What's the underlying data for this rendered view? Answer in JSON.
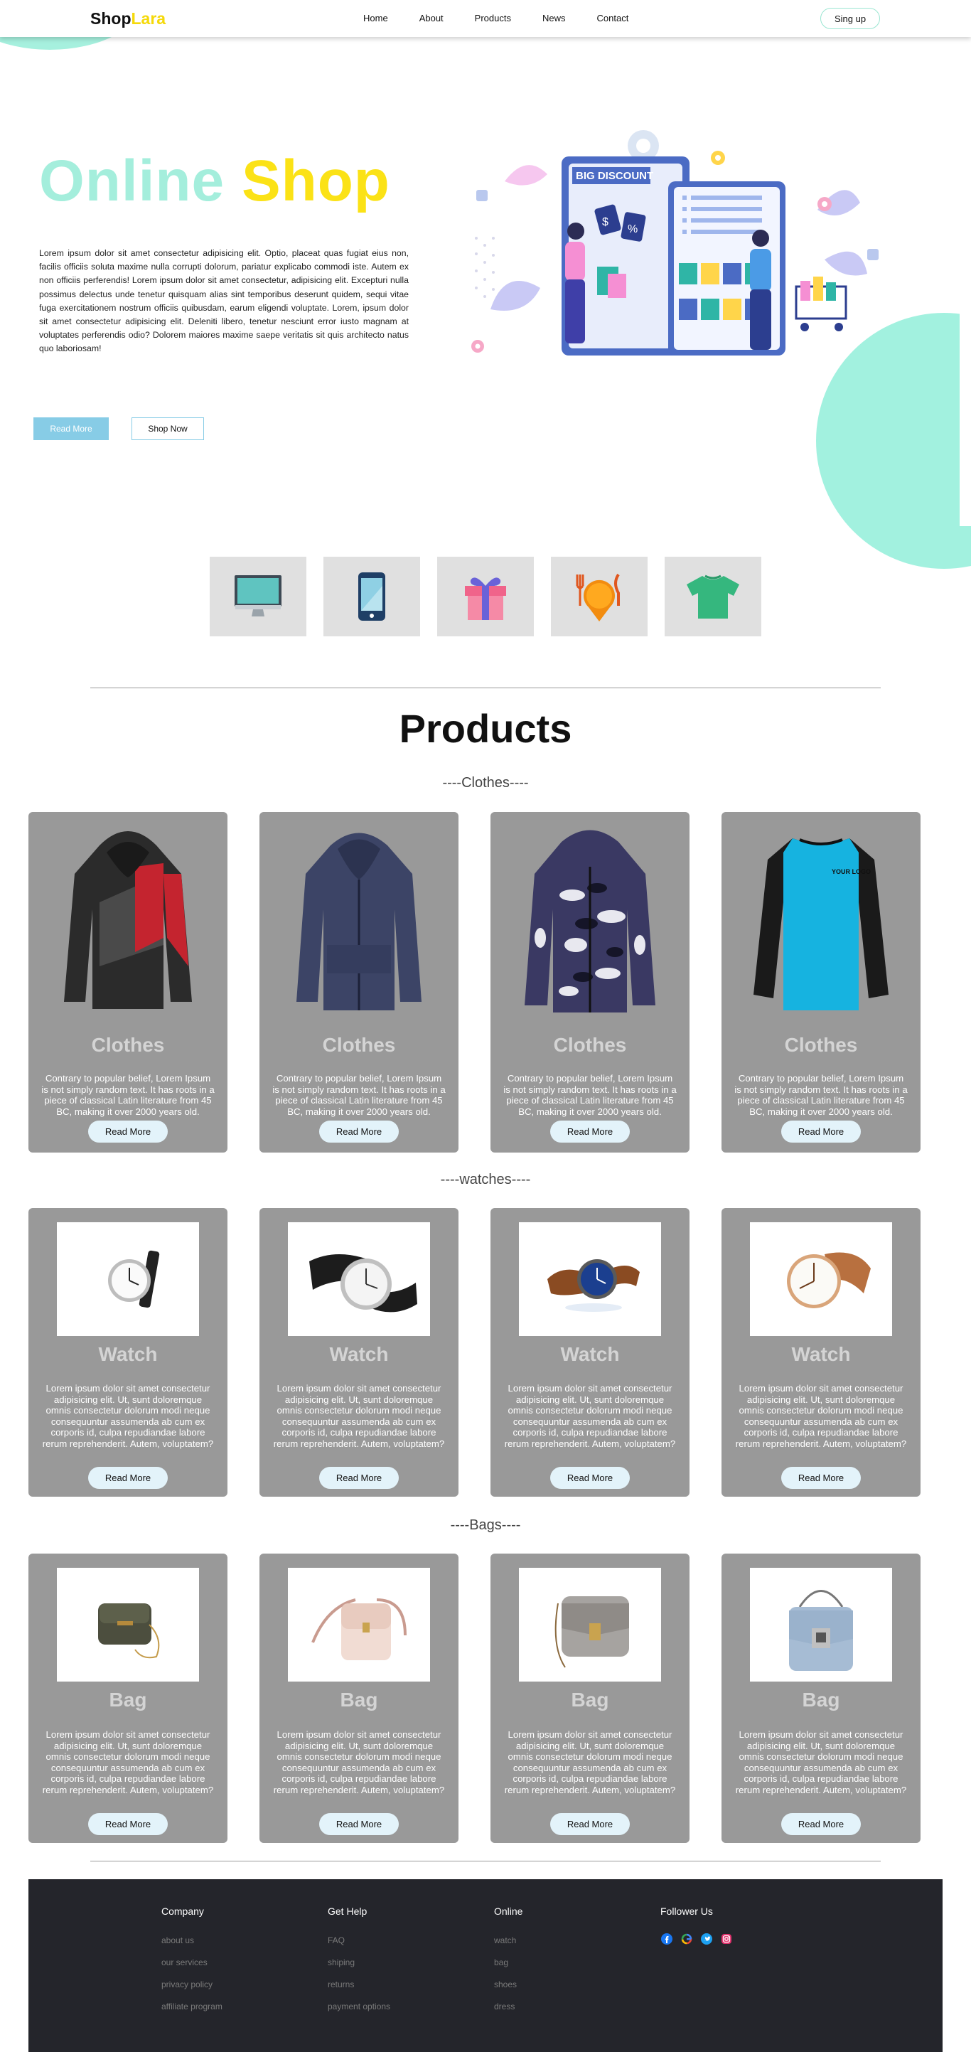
{
  "header": {
    "logo_part1": "Shop",
    "logo_part2": "Lara",
    "nav": [
      "Home",
      "About",
      "Products",
      "News",
      "Contact"
    ],
    "signup_label": "Sing up"
  },
  "hero": {
    "title_part1": "Online",
    "title_part2": "Shop",
    "text": "Lorem ipsum dolor sit amet consectetur adipisicing elit. Optio, placeat quas fugiat eius non, facilis officiis soluta maxime nulla corrupti dolorum, pariatur explicabo commodi iste. Autem ex non officiis perferendis! Lorem ipsum dolor sit amet consectetur, adipisicing elit. Excepturi nulla possimus delectus unde tenetur quisquam alias sint temporibus deserunt quidem, sequi vitae fuga exercitationem nostrum officiis quibusdam, earum eligendi voluptate. Lorem, ipsum dolor sit amet consectetur adipisicing elit. Deleniti libero, tenetur nesciunt error iusto magnam at voluptates perferendis odio? Dolorem maiores maxime saepe veritatis sit quis architecto natus quo laboriosam!",
    "read_more": "Read More",
    "shop_now": "Shop Now",
    "illustration_text": "BIG DISCOUNT"
  },
  "categories": [
    "monitor-icon",
    "smartphone-icon",
    "gift-icon",
    "food-icon",
    "tshirt-icon"
  ],
  "products": {
    "title": "Products",
    "sections": [
      {
        "label": "----Clothes----",
        "items": [
          {
            "title": "Clothes",
            "desc": "Contrary to popular belief, Lorem Ipsum is not simply random text. It has roots in a piece of classical Latin literature from 45 BC, making it over 2000 years old.",
            "button": "Read More",
            "image": "hoodie-red-black"
          },
          {
            "title": "Clothes",
            "desc": "Contrary to popular belief, Lorem Ipsum is not simply random text. It has roots in a piece of classical Latin literature from 45 BC, making it over 2000 years old.",
            "button": "Read More",
            "image": "hoodie-navy"
          },
          {
            "title": "Clothes",
            "desc": "Contrary to popular belief, Lorem Ipsum is not simply random text. It has roots in a piece of classical Latin literature from 45 BC, making it over 2000 years old.",
            "button": "Read More",
            "image": "jacket-camo"
          },
          {
            "title": "Clothes",
            "desc": "Contrary to popular belief, Lorem Ipsum is not simply random text. It has roots in a piece of classical Latin literature from 45 BC, making it over 2000 years old.",
            "button": "Read More",
            "image": "raglan-tee-blue",
            "logo_text": "YOUR LOGO"
          }
        ]
      },
      {
        "label": "----watches----",
        "items": [
          {
            "title": "Watch",
            "desc": "Lorem ipsum dolor sit amet consectetur adipisicing elit. Ut, sunt doloremque omnis consectetur dolorum modi neque consequuntur assumenda ab cum ex corporis id, culpa repudiandae labore rerum reprehenderit. Autem, voluptatem?",
            "button": "Read More",
            "image": "watch-black-strap"
          },
          {
            "title": "Watch",
            "desc": "Lorem ipsum dolor sit amet consectetur adipisicing elit. Ut, sunt doloremque omnis consectetur dolorum modi neque consequuntur assumenda ab cum ex corporis id, culpa repudiandae labore rerum reprehenderit. Autem, voluptatem?",
            "button": "Read More",
            "image": "watch-silver"
          },
          {
            "title": "Watch",
            "desc": "Lorem ipsum dolor sit amet consectetur adipisicing elit. Ut, sunt doloremque omnis consectetur dolorum modi neque consequuntur assumenda ab cum ex corporis id, culpa repudiandae labore rerum reprehenderit. Autem, voluptatem?",
            "button": "Read More",
            "image": "watch-blue-dial"
          },
          {
            "title": "Watch",
            "desc": "Lorem ipsum dolor sit amet consectetur adipisicing elit. Ut, sunt doloremque omnis consectetur dolorum modi neque consequuntur assumenda ab cum ex corporis id, culpa repudiandae labore rerum reprehenderit. Autem, voluptatem?",
            "button": "Read More",
            "image": "watch-brown-strap"
          }
        ]
      },
      {
        "label": "----Bags----",
        "items": [
          {
            "title": "Bag",
            "desc": "Lorem ipsum dolor sit amet consectetur adipisicing elit. Ut, sunt doloremque omnis consectetur dolorum modi neque consequuntur assumenda ab cum ex corporis id, culpa repudiandae labore rerum reprehenderit. Autem, voluptatem?",
            "button": "Read More",
            "image": "bag-olive"
          },
          {
            "title": "Bag",
            "desc": "Lorem ipsum dolor sit amet consectetur adipisicing elit. Ut, sunt doloremque omnis consectetur dolorum modi neque consequuntur assumenda ab cum ex corporis id, culpa repudiandae labore rerum reprehenderit. Autem, voluptatem?",
            "button": "Read More",
            "image": "bag-pink"
          },
          {
            "title": "Bag",
            "desc": "Lorem ipsum dolor sit amet consectetur adipisicing elit. Ut, sunt doloremque omnis consectetur dolorum modi neque consequuntur assumenda ab cum ex corporis id, culpa repudiandae labore rerum reprehenderit. Autem, voluptatem?",
            "button": "Read More",
            "image": "bag-grey"
          },
          {
            "title": "Bag",
            "desc": "Lorem ipsum dolor sit amet consectetur adipisicing elit. Ut, sunt doloremque omnis consectetur dolorum modi neque consequuntur assumenda ab cum ex corporis id, culpa repudiandae labore rerum reprehenderit. Autem, voluptatem?",
            "button": "Read More",
            "image": "bag-light-blue"
          }
        ]
      }
    ]
  },
  "footer": {
    "columns": [
      {
        "heading": "Company",
        "links": [
          "about us",
          "our services",
          "privacy policy",
          "affiliate program"
        ]
      },
      {
        "heading": "Get Help",
        "links": [
          "FAQ",
          "shiping",
          "returns",
          "payment options"
        ]
      },
      {
        "heading": "Online",
        "links": [
          "watch",
          "bag",
          "shoes",
          "dress"
        ]
      }
    ],
    "follow_heading": "Follower Us",
    "socials": [
      "facebook-icon",
      "google-icon",
      "twitter-icon",
      "instagram-icon"
    ]
  },
  "colors": {
    "accent_mint": "#a4eedc",
    "accent_yellow": "#fbe216",
    "button_blue": "#87cce6",
    "card_grey": "#999999",
    "footer_bg": "#24252b"
  }
}
